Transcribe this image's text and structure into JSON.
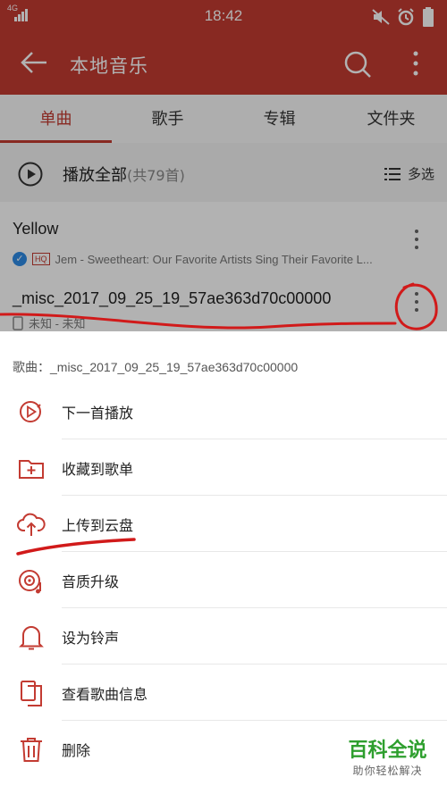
{
  "status": {
    "network": "4G",
    "time": "18:42"
  },
  "appbar": {
    "title": "本地音乐"
  },
  "tabs": [
    {
      "label": "单曲",
      "active": true
    },
    {
      "label": "歌手",
      "active": false
    },
    {
      "label": "专辑",
      "active": false
    },
    {
      "label": "文件夹",
      "active": false
    }
  ],
  "playall": {
    "label": "播放全部",
    "count": "(共79首)",
    "multi_label": "多选"
  },
  "songs": [
    {
      "title": "Yellow",
      "quality": "HQ",
      "subtitle": "Jem - Sweetheart: Our Favorite Artists Sing Their Favorite L..."
    },
    {
      "title": "_misc_2017_09_25_19_57ae363d70c00000",
      "subtitle": "未知 - 未知"
    }
  ],
  "sheet": {
    "title": "歌曲：_misc_2017_09_25_19_57ae363d70c00000",
    "items": [
      {
        "label": "下一首播放",
        "icon": "play-next-icon"
      },
      {
        "label": "收藏到歌单",
        "icon": "add-folder-icon"
      },
      {
        "label": "上传到云盘",
        "icon": "cloud-upload-icon"
      },
      {
        "label": "音质升级",
        "icon": "quality-upgrade-icon"
      },
      {
        "label": "设为铃声",
        "icon": "bell-icon"
      },
      {
        "label": "查看歌曲信息",
        "icon": "song-info-icon"
      },
      {
        "label": "删除",
        "icon": "trash-icon"
      }
    ]
  },
  "watermark": {
    "brand": "百科全说",
    "slogan": "助你轻松解决"
  },
  "colors": {
    "brand_red": "#c33b32",
    "watermark_green": "#2e9f2e",
    "verified_blue": "#2f8be6"
  }
}
